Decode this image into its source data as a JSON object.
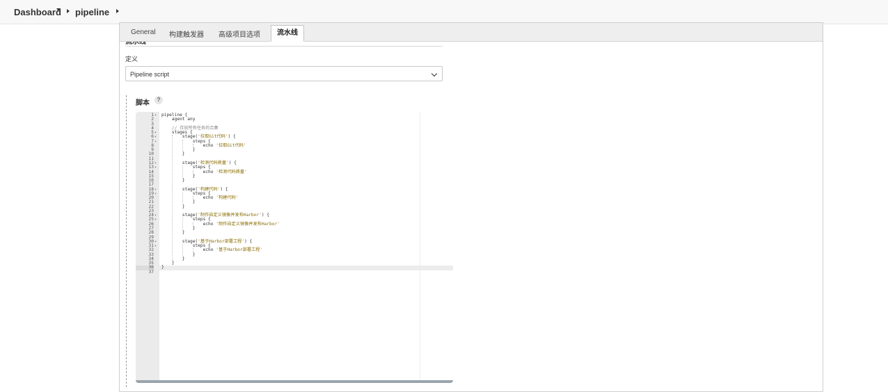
{
  "breadcrumb": {
    "items": [
      "Dashboard",
      "pipeline"
    ]
  },
  "tabs": [
    {
      "label": "General",
      "active": false
    },
    {
      "label": "构建触发器",
      "active": false
    },
    {
      "label": "高级项目选项",
      "active": false
    },
    {
      "label": "流水线",
      "active": true
    }
  ],
  "section_title": "流水线",
  "definition": {
    "label": "定义",
    "selected": "Pipeline script"
  },
  "script": {
    "label": "脚本",
    "help": "?",
    "current_line": 36,
    "lines": [
      {
        "n": "1",
        "fold": "▾",
        "text": "pipeline {"
      },
      {
        "n": "2",
        "fold": "",
        "text": "    agent any"
      },
      {
        "n": "3",
        "fold": "",
        "text": ""
      },
      {
        "n": "4",
        "fold": "",
        "text": "    // 存放所有任务的合集"
      },
      {
        "n": "5",
        "fold": "▾",
        "text": "    stages {"
      },
      {
        "n": "6",
        "fold": "▾",
        "text": "        stage('拉取Git代码') {"
      },
      {
        "n": "7",
        "fold": "▾",
        "text": "            steps {"
      },
      {
        "n": "8",
        "fold": "",
        "text": "                echo '拉取Git代码'"
      },
      {
        "n": "9",
        "fold": "",
        "text": "            }"
      },
      {
        "n": "10",
        "fold": "",
        "text": "        }"
      },
      {
        "n": "11",
        "fold": "",
        "text": ""
      },
      {
        "n": "12",
        "fold": "▾",
        "text": "        stage('检测代码质量') {"
      },
      {
        "n": "13",
        "fold": "▾",
        "text": "            steps {"
      },
      {
        "n": "14",
        "fold": "",
        "text": "                echo '检测代码质量'"
      },
      {
        "n": "15",
        "fold": "",
        "text": "            }"
      },
      {
        "n": "16",
        "fold": "",
        "text": "        }"
      },
      {
        "n": "17",
        "fold": "",
        "text": ""
      },
      {
        "n": "18",
        "fold": "▾",
        "text": "        stage('构建代码') {"
      },
      {
        "n": "19",
        "fold": "▾",
        "text": "            steps {"
      },
      {
        "n": "20",
        "fold": "",
        "text": "                echo '构建代码'"
      },
      {
        "n": "21",
        "fold": "",
        "text": "            }"
      },
      {
        "n": "22",
        "fold": "",
        "text": "        }"
      },
      {
        "n": "23",
        "fold": "",
        "text": ""
      },
      {
        "n": "24",
        "fold": "▾",
        "text": "        stage('制作自定义镜像并发布Harbor') {"
      },
      {
        "n": "25",
        "fold": "▾",
        "text": "            steps {"
      },
      {
        "n": "26",
        "fold": "",
        "text": "                echo '制作自定义镜像并发布Harbor'"
      },
      {
        "n": "27",
        "fold": "",
        "text": "            }"
      },
      {
        "n": "28",
        "fold": "",
        "text": "        }"
      },
      {
        "n": "29",
        "fold": "",
        "text": ""
      },
      {
        "n": "30",
        "fold": "▾",
        "text": "        stage('基于Harbor部署工程') {"
      },
      {
        "n": "31",
        "fold": "▾",
        "text": "            steps {"
      },
      {
        "n": "32",
        "fold": "",
        "text": "                echo '基于Harbor部署工程'"
      },
      {
        "n": "33",
        "fold": "",
        "text": "            }"
      },
      {
        "n": "34",
        "fold": "",
        "text": "        }"
      },
      {
        "n": "35",
        "fold": "",
        "text": "    }"
      },
      {
        "n": "36",
        "fold": "",
        "text": "}"
      },
      {
        "n": "37",
        "fold": "",
        "text": ""
      }
    ]
  }
}
